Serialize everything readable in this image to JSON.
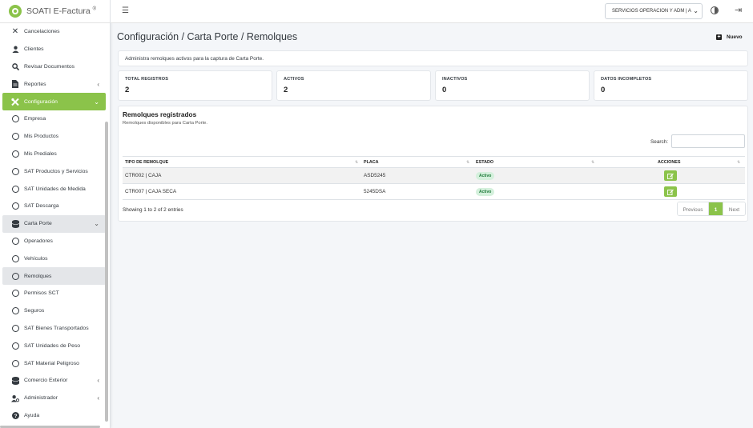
{
  "app": {
    "name": "SOATI E-Factura",
    "reg": "®"
  },
  "sidebar": {
    "items": [
      {
        "label": "Cancelaciones",
        "icon": "close-icon"
      },
      {
        "label": "Clientes",
        "icon": "user-icon"
      },
      {
        "label": "Revisar Documentos",
        "icon": "search-icon"
      },
      {
        "label": "Reportes",
        "icon": "document-icon"
      },
      {
        "label": "Configuración",
        "icon": "tools-icon"
      },
      {
        "label": "Empresa"
      },
      {
        "label": "Mis Productos"
      },
      {
        "label": "Mis Prediales"
      },
      {
        "label": "SAT Productos y Servicios"
      },
      {
        "label": "SAT Unidades de Medida"
      },
      {
        "label": "SAT Descarga"
      },
      {
        "label": "Carta Porte",
        "icon": "database-icon"
      },
      {
        "label": "Operadores"
      },
      {
        "label": "Vehículos"
      },
      {
        "label": "Remolques"
      },
      {
        "label": "Permisos SCT"
      },
      {
        "label": "Seguros"
      },
      {
        "label": "SAT Bienes Transportados"
      },
      {
        "label": "SAT Unidades de Peso"
      },
      {
        "label": "SAT Material Peligroso"
      },
      {
        "label": "Comercio Exterior",
        "icon": "database-icon"
      },
      {
        "label": "Administrador",
        "icon": "user-gear-icon"
      },
      {
        "label": "Ayuda",
        "icon": "help-icon"
      }
    ]
  },
  "topbar": {
    "company": "SERVICIOS OPERACION Y ADM | A"
  },
  "page": {
    "title": "Configuración / Carta Porte / Remolques",
    "new_label": "Nuevo",
    "info": "Administra remolques activos para la captura de Carta Porte."
  },
  "stats": [
    {
      "label": "TOTAL REGISTROS",
      "value": "2"
    },
    {
      "label": "ACTIVOS",
      "value": "2"
    },
    {
      "label": "INACTIVOS",
      "value": "0"
    },
    {
      "label": "DATOS INCOMPLETOS",
      "value": "0"
    }
  ],
  "table": {
    "title": "Remolques registrados",
    "subtitle": "Remolques disponibles para Carta Porte.",
    "search_label": "Search:",
    "columns": [
      "TIPO DE REMOLQUE",
      "PLACA",
      "ESTADO",
      "ACCIONES"
    ],
    "rows": [
      {
        "tipo": "CTR002 | CAJA",
        "placa": "ASD5245",
        "estado": "Activo"
      },
      {
        "tipo": "CTR007 | CAJA SECA",
        "placa": "5245DSA",
        "estado": "Activo"
      }
    ],
    "showing": "Showing 1 to 2 of 2 entries",
    "pager": {
      "prev": "Previous",
      "current": "1",
      "next": "Next"
    }
  },
  "colors": {
    "accent": "#8bc34a",
    "badge_bg": "#d4f0dc",
    "badge_text": "#1f7a3a"
  }
}
